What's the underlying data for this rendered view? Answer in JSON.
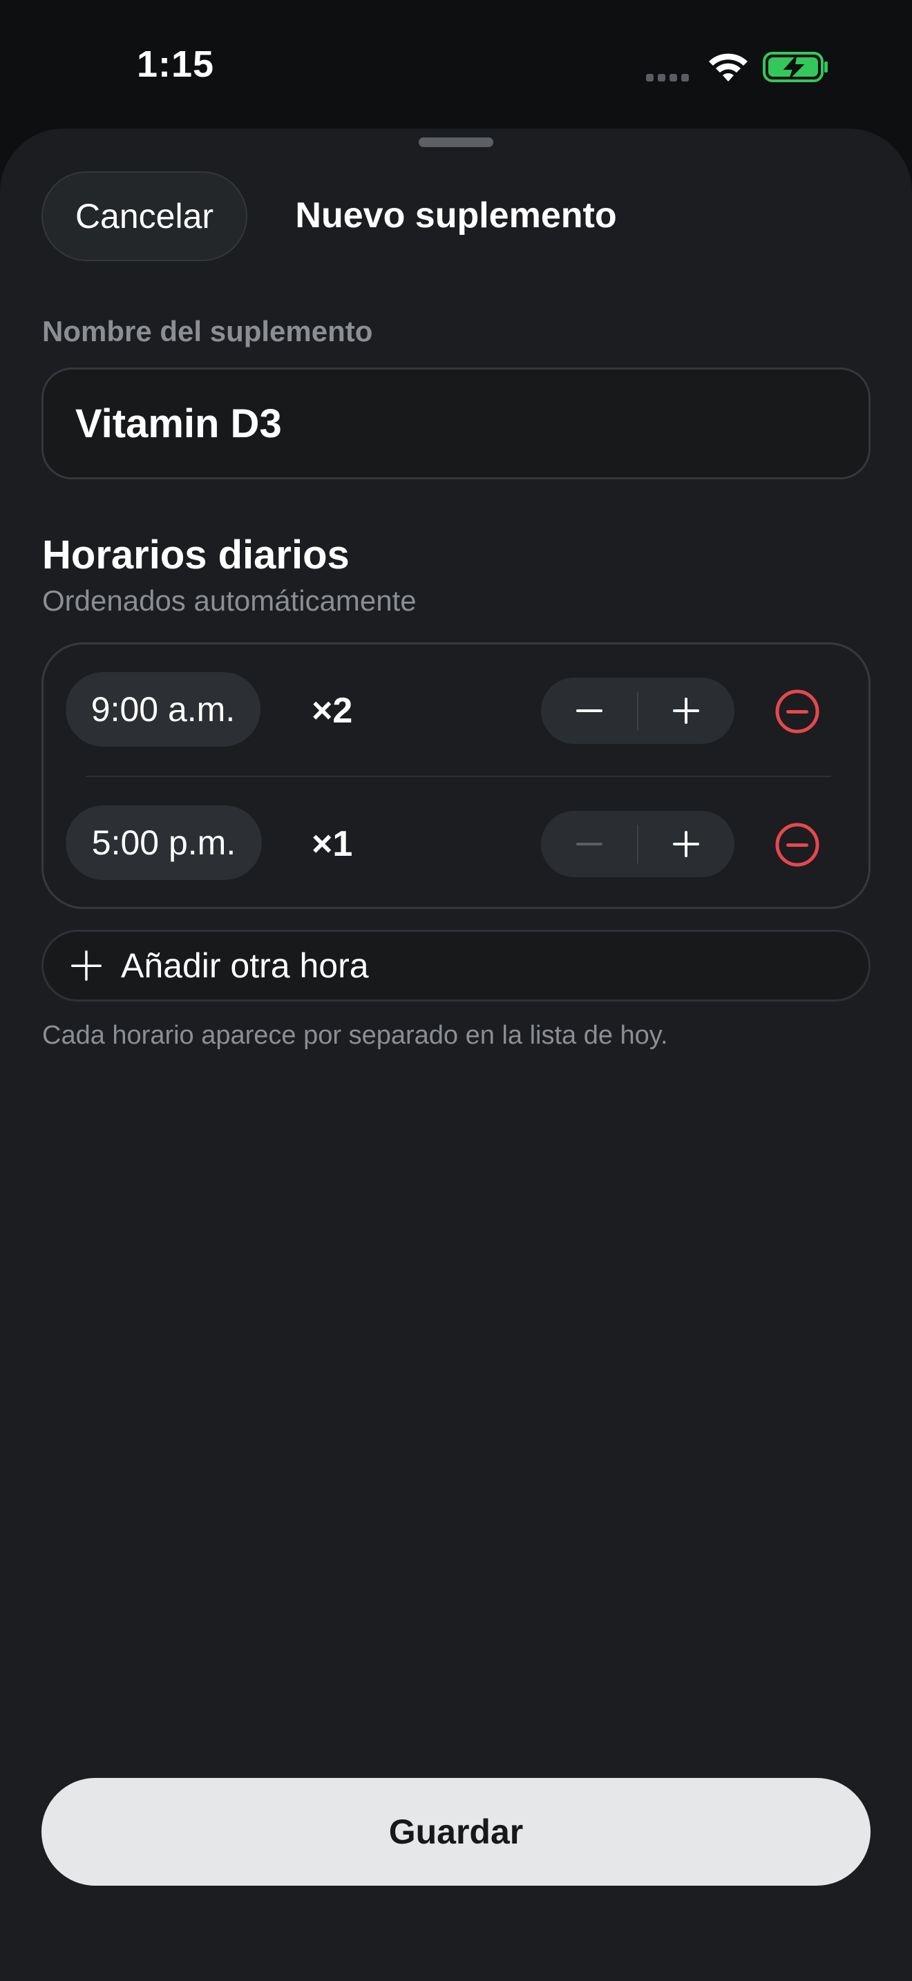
{
  "status_bar": {
    "time": "1:15",
    "icons": [
      "cellular-signal-icon",
      "wifi-icon",
      "battery-charging-icon"
    ],
    "battery_color": "#34c759"
  },
  "header": {
    "cancel_label": "Cancelar",
    "title": "Nuevo suplemento"
  },
  "name_field": {
    "label": "Nombre del suplemento",
    "value": "Vitamin D3"
  },
  "schedule": {
    "title": "Horarios diarios",
    "subtitle": "Ordenados automáticamente",
    "rows": [
      {
        "time": "9:00 a.m.",
        "count": "×2",
        "minus_enabled": true,
        "plus_enabled": true
      },
      {
        "time": "5:00 p.m.",
        "count": "×1",
        "minus_enabled": false,
        "plus_enabled": true
      }
    ],
    "add_label": "Añadir otra hora",
    "helper": "Cada horario aparece por separado en la lista de hoy."
  },
  "footer": {
    "save_label": "Guardar"
  },
  "colors": {
    "sheet_background": "#1b1d20",
    "remove_red": "#e5484d",
    "save_background": "#e6e7e9"
  }
}
